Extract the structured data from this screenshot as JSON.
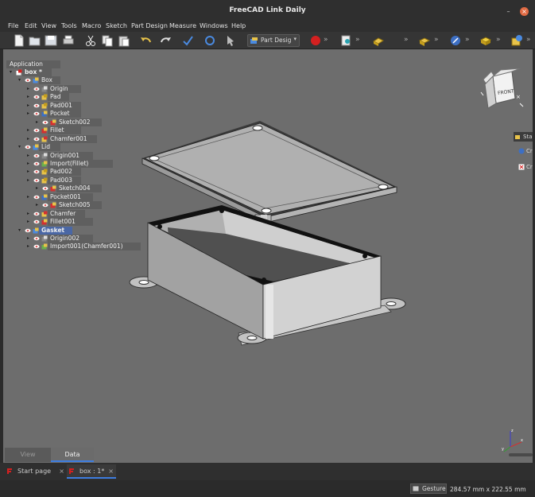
{
  "window": {
    "title": "FreeCAD Link Daily",
    "minimize_glyph": "–",
    "close_glyph": "×"
  },
  "menu": [
    "File",
    "Edit",
    "View",
    "Tools",
    "Macro",
    "Sketch",
    "Part Design",
    "Measure",
    "Windows",
    "Help"
  ],
  "toolbar": {
    "workbench": "Part Desig",
    "overflow_glyph": "»",
    "dropdown_glyph": "▾",
    "icons": [
      "new-file-icon",
      "open-file-icon",
      "save-icon",
      "print-icon",
      "cut-icon",
      "copy-icon",
      "paste-icon",
      "undo-icon",
      "redo-icon",
      "refresh-icon",
      "recompute-icon",
      "whats-this-icon",
      "macro-record-icon",
      "macro-run-icon",
      "body-icon",
      "pad-icon",
      "sketch-icon",
      "part-icon",
      "box-icon"
    ]
  },
  "tree": {
    "header": "Application",
    "items": [
      {
        "label": "box *",
        "depth": 0,
        "bold": true,
        "icon": "document-icon"
      },
      {
        "label": "Box",
        "depth": 1,
        "icon": "body-icon"
      },
      {
        "label": "Origin",
        "depth": 2,
        "icon": "origin-icon"
      },
      {
        "label": "Pad",
        "depth": 2,
        "icon": "pad-icon"
      },
      {
        "label": "Pad001",
        "depth": 2,
        "icon": "pad-icon"
      },
      {
        "label": "Pocket",
        "depth": 2,
        "icon": "pocket-icon"
      },
      {
        "label": "Sketch002",
        "depth": 3,
        "icon": "sketch-icon"
      },
      {
        "label": "Fillet",
        "depth": 2,
        "icon": "fillet-icon"
      },
      {
        "label": "Chamfer001",
        "depth": 2,
        "icon": "chamfer-icon"
      },
      {
        "label": "Lid",
        "depth": 1,
        "icon": "body-icon"
      },
      {
        "label": "Origin001",
        "depth": 2,
        "icon": "origin-icon"
      },
      {
        "label": "Import(Fillet)",
        "depth": 2,
        "icon": "import-icon"
      },
      {
        "label": "Pad002",
        "depth": 2,
        "icon": "pad-icon"
      },
      {
        "label": "Pad003",
        "depth": 2,
        "icon": "pad-icon"
      },
      {
        "label": "Sketch004",
        "depth": 3,
        "icon": "sketch-icon"
      },
      {
        "label": "Pocket001",
        "depth": 2,
        "icon": "pocket-icon"
      },
      {
        "label": "Sketch005",
        "depth": 3,
        "icon": "sketch-icon"
      },
      {
        "label": "Chamfer",
        "depth": 2,
        "icon": "chamfer-icon"
      },
      {
        "label": "Fillet001",
        "depth": 2,
        "icon": "fillet-icon"
      },
      {
        "label": "Gasket",
        "depth": 1,
        "bold": true,
        "selected": true,
        "icon": "body-icon"
      },
      {
        "label": "Origin002",
        "depth": 2,
        "icon": "origin-icon"
      },
      {
        "label": "Import001(Chamfer001)",
        "depth": 2,
        "icon": "import-icon"
      }
    ]
  },
  "navcube": {
    "face": "FRONT"
  },
  "side_panel": {
    "header": "Sta",
    "items": [
      "Cr",
      "Cr"
    ]
  },
  "combo_tabs": [
    "View",
    "Data"
  ],
  "doc_tabs": [
    {
      "label": "Start page",
      "close": "×"
    },
    {
      "label": "box : 1*",
      "close": "×"
    }
  ],
  "status": {
    "navigation_style": "Gesture",
    "dimensions": "284.57 mm x 222.55 mm"
  },
  "colors": {
    "viewport": "#6d6d6d",
    "accent": "#3d7de0",
    "selection": "#4a67a5"
  }
}
